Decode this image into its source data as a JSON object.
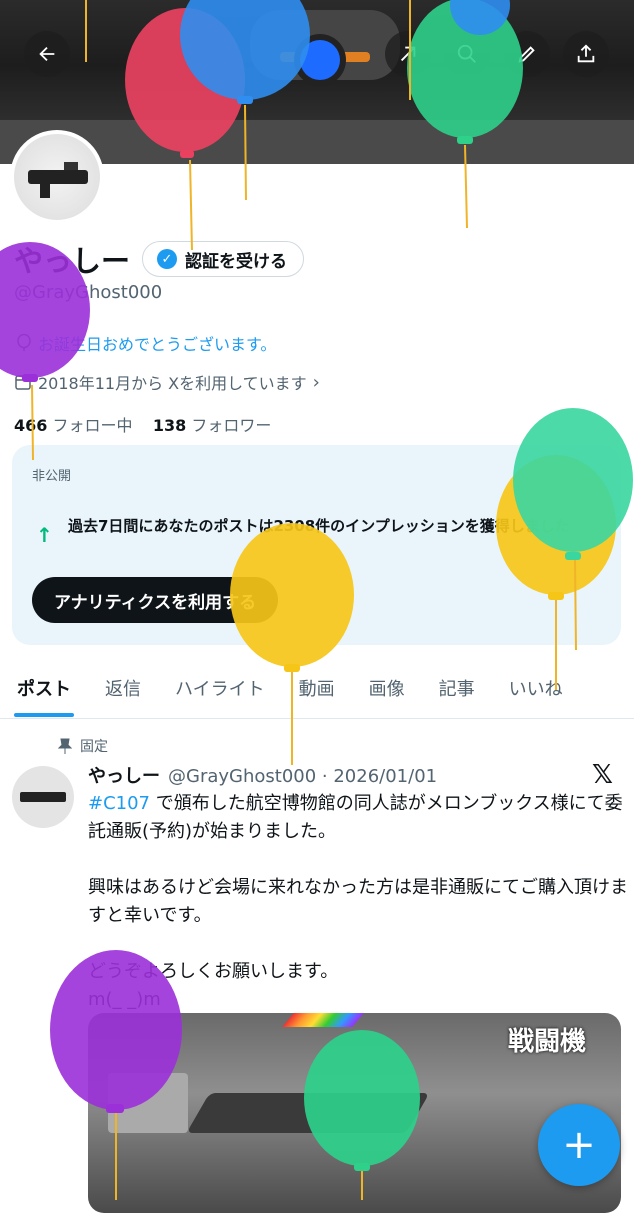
{
  "header": {
    "buttons": [
      "back-arrow-icon",
      "grok-icon",
      "search-icon",
      "edit-icon",
      "share-icon"
    ]
  },
  "profile": {
    "name": "やっしー",
    "verify_label": "認証を受ける",
    "handle": "@GrayGhost000",
    "birthday_message": "お誕生日おめでとうございます。",
    "joined": "2018年11月から Xを利用しています",
    "following_count": "466",
    "following_label": "フォロー中",
    "followers_count": "138",
    "followers_label": "フォロワー"
  },
  "analytics": {
    "private_label": "非公開",
    "impressions_text": "過去7日間にあなたのポストは2308件のインプレッションを獲得しました",
    "button_label": "アナリティクスを利用する"
  },
  "tabs": [
    {
      "label": "ポスト"
    },
    {
      "label": "返信"
    },
    {
      "label": "ハイライト"
    },
    {
      "label": "動画"
    },
    {
      "label": "画像"
    },
    {
      "label": "記事"
    },
    {
      "label": "いいね"
    }
  ],
  "post": {
    "pinned_label": "固定",
    "author_name": "やっしー",
    "author_meta": "@GrayGhost000 · 2026/01/01",
    "hashtag": "#C107",
    "line1": " で頒布した航空博物館の同人誌がメロンブックス様にて委託通販(予約)が始まりました。",
    "line2": "興味はあるけど会場に来れなかった方は是非通販にてご購入頂けますと幸いです。",
    "line3": "どうぞよろしくお願いします。",
    "line4": "m(_ _)m",
    "media_caption": "戦闘機"
  },
  "colors": {
    "accent": "#1d9bf0",
    "text": "#0f1419",
    "muted": "#536471"
  }
}
